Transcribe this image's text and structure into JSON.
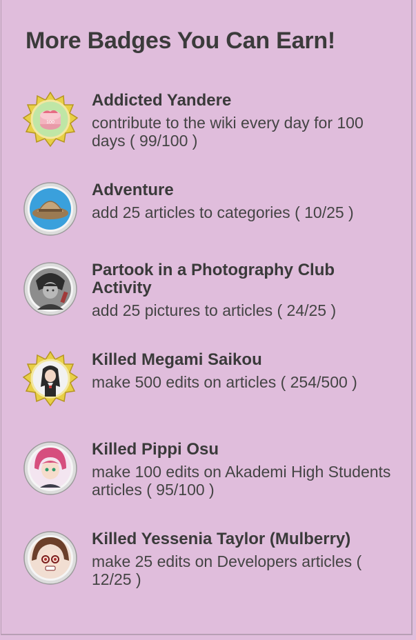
{
  "section": {
    "title": "More Badges You Can Earn!"
  },
  "badges": [
    {
      "name": "Addicted Yandere",
      "description": "contribute to the wiki every day for 100 days",
      "progress": "( 99/100 )",
      "icon": "cake-badge-icon"
    },
    {
      "name": "Adventure",
      "description": "add 25 articles to categories",
      "progress": "( 10/25 )",
      "icon": "pith-helmet-badge-icon"
    },
    {
      "name": "Partook in a Photography Club Activity",
      "description": "add 25 pictures to articles",
      "progress": "( 24/25 )",
      "icon": "photo-club-badge-icon"
    },
    {
      "name": "Killed Megami Saikou",
      "description": "make 500 edits on articles",
      "progress": "( 254/500 )",
      "icon": "megami-badge-icon"
    },
    {
      "name": "Killed Pippi Osu",
      "description": "make 100 edits on Akademi High Students articles",
      "progress": "( 95/100 )",
      "icon": "pippi-badge-icon"
    },
    {
      "name": "Killed Yessenia Taylor (Mulberry)",
      "description": "make 25 edits on Developers articles",
      "progress": "( 12/25 )",
      "icon": "mulberry-badge-icon"
    }
  ],
  "colors": {
    "background": "#e0bddc",
    "text": "#3a3a3a",
    "gold_frame": "#d9b93a",
    "silver_frame": "#c8c8c8"
  }
}
